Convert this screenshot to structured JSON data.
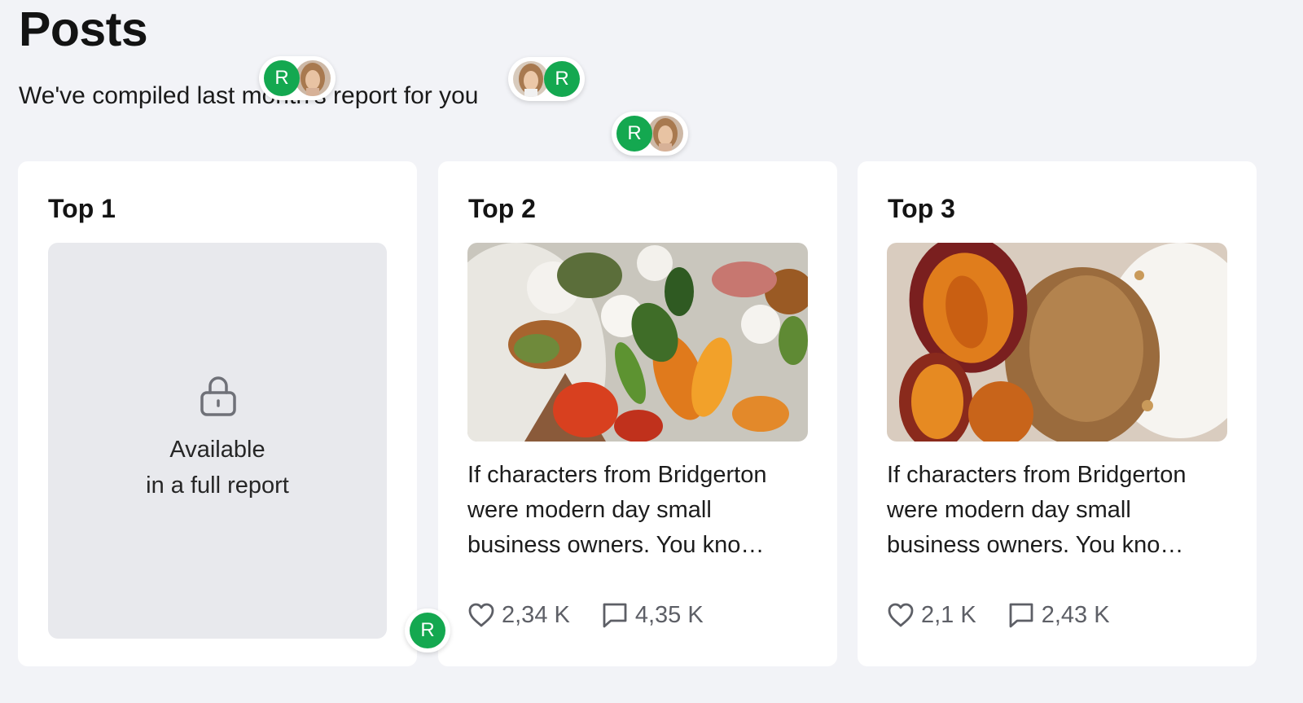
{
  "page": {
    "title": "Posts",
    "subtitle": "We've compiled last month's report for you"
  },
  "cards": [
    {
      "title": "Top 1",
      "locked": true,
      "locked_line1": "Available",
      "locked_line2": "in a full report",
      "icon": "lock-icon"
    },
    {
      "title": "Top 2",
      "text": "If characters from Bridgerton were modern day small business owners. You kno…",
      "likes": "2,34 K",
      "comments": "4,35 K",
      "image": "salad with peaches, tomatoes and burrata"
    },
    {
      "title": "Top 3",
      "text": "If characters from Bridgerton were modern day small business owners. You kno…",
      "likes": "2,1 K",
      "comments": "2,43 K",
      "image": "roasted plums with granola and yogurt"
    }
  ],
  "presence": {
    "initial": "R",
    "color": "#14a850"
  },
  "colors": {
    "background": "#f2f3f7",
    "card": "#ffffff",
    "locked_area": "#e8e9ed",
    "accent": "#14a850",
    "stat_text": "#5d5f66"
  }
}
